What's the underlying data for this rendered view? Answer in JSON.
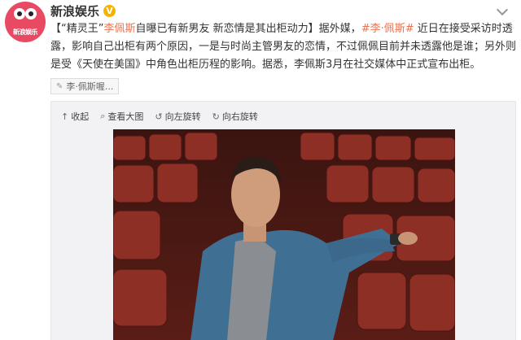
{
  "account": {
    "name": "新浪娱乐",
    "verified_badge": "V",
    "avatar_text": "新浪娱乐",
    "accent_color": "#e94a63"
  },
  "post": {
    "title_open": "【",
    "title_nick": "“精灵王”",
    "title_person": "李佩斯",
    "title_rest": "自曝已有新男友 新恋情是其出柜动力",
    "title_close": "】",
    "text_1": "据外媒，",
    "topic": "#李·佩斯#",
    "text_2": " 近日在接受采访时透露，影响自己出柜有两个原因，一是与时尚主管男友的恋情，不过佩佩目前并未透露他是谁；另外则是受《天使在美国》中角色出柜历程的影响。据悉，李佩斯3月在社交媒体中正式宣布出柜。",
    "link_color": "#eb7350"
  },
  "tag": {
    "icon": "tag-icon",
    "label": "李·佩斯喔..."
  },
  "toolbar": {
    "collapse": "收起",
    "view_large": "查看大图",
    "rotate_left": "向左旋转",
    "rotate_right": "向右旋转"
  }
}
